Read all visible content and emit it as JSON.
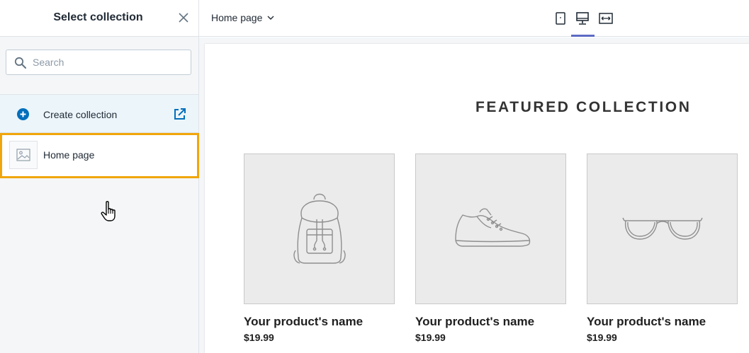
{
  "sidebar": {
    "title": "Select collection",
    "search_placeholder": "Search",
    "create_label": "Create collection",
    "items": [
      {
        "label": "Home page"
      }
    ]
  },
  "topbar": {
    "page_selector": "Home page"
  },
  "preview": {
    "section_title": "FEATURED COLLECTION",
    "products": [
      {
        "name": "Your product's name",
        "price": "$19.99",
        "icon": "backpack-icon"
      },
      {
        "name": "Your product's name",
        "price": "$19.99",
        "icon": "sneaker-icon"
      },
      {
        "name": "Your product's name",
        "price": "$19.99",
        "icon": "glasses-icon"
      }
    ]
  },
  "colors": {
    "accent": "#5c6ac4",
    "highlight": "#f0a60a",
    "link_blue": "#006fbb",
    "selected_row_bg": "#ebf5fa"
  }
}
